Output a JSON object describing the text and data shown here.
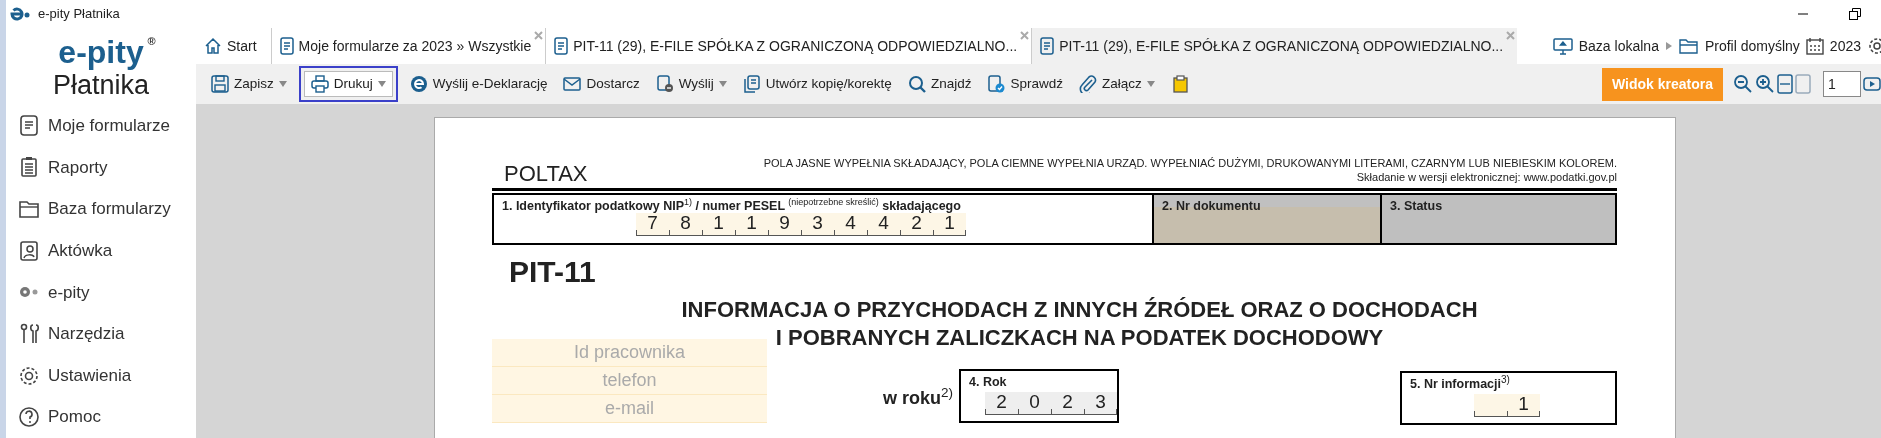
{
  "window": {
    "title": "e-pity Płatnika"
  },
  "sidebar": {
    "logo": {
      "brand": "e-pity",
      "registered": "®",
      "product": "Płatnika"
    },
    "items": [
      {
        "label": "Moje formularze"
      },
      {
        "label": "Raporty"
      },
      {
        "label": "Baza formularzy"
      },
      {
        "label": "Aktówka"
      },
      {
        "label": "e-pity"
      },
      {
        "label": "Narzędzia"
      },
      {
        "label": "Ustawienia"
      },
      {
        "label": "Pomoc"
      }
    ]
  },
  "tabs": [
    {
      "label": "Start",
      "selected": false,
      "closable": false
    },
    {
      "label": "Moje formularze za 2023 » Wszystkie",
      "selected": false,
      "closable": true
    },
    {
      "label": "PIT-11 (29), E-FILE SPÓŁKA Z OGRANICZONĄ ODPOWIEDZIALNO...",
      "selected": false,
      "closable": true
    },
    {
      "label": "PIT-11 (29), E-FILE SPÓŁKA Z OGRANICZONĄ ODPOWIEDZIALNO...",
      "selected": true,
      "closable": true
    }
  ],
  "status": {
    "database": "Baza lokalna",
    "profile": "Profil domyślny",
    "year": "2023"
  },
  "toolbar": {
    "buttons": [
      {
        "label": "Zapisz",
        "dropdown": true,
        "focused": false
      },
      {
        "label": "Drukuj",
        "dropdown": true,
        "focused": true
      },
      {
        "label": "Wyślij e-Deklarację",
        "dropdown": false,
        "focused": false
      },
      {
        "label": "Dostarcz",
        "dropdown": false,
        "focused": false
      },
      {
        "label": "Wyślij",
        "dropdown": true,
        "focused": false
      },
      {
        "label": "Utwórz kopię/korektę",
        "dropdown": false,
        "focused": false
      },
      {
        "label": "Znajdź",
        "dropdown": false,
        "focused": false
      },
      {
        "label": "Sprawdź",
        "dropdown": false,
        "focused": false
      },
      {
        "label": "Załącz",
        "dropdown": true,
        "focused": false
      },
      {
        "dropdown": false,
        "focused": false
      }
    ],
    "mode_button": "Widok kreatora",
    "page": "1"
  },
  "form": {
    "system": "POLTAX",
    "instructions": "POLA JASNE WYPEŁNIA SKŁADAJĄCY, POLA CIEMNE WYPEŁNIA URZĄD. WYPEŁNIAĆ DUŻYMI, DRUKOWANYMI LITERAMI, CZARNYM LUB NIEBIESKIM KOLOREM.",
    "submission": "Składanie w wersji elektronicznej: www.podatki.gov.pl",
    "id_field": {
      "label": "1. Identyfikator podatkowy NIP$^{1)}$ / numer PESEL $^{(niepotrzebne skreślić)}$ składającego",
      "digits": [
        "7",
        "8",
        "1",
        "1",
        "9",
        "3",
        "4",
        "4",
        "2",
        "1"
      ]
    },
    "doc_number": {
      "label": "2. Nr dokumentu"
    },
    "status_field": {
      "label": "3. Status"
    },
    "code": "PIT-11",
    "heading": [
      "INFORMACJA O PRZYCHODACH Z INNYCH ŹRÓDEŁ ORAZ O DOCHODACH",
      "I POBRANYCH ZALICZKACH NA PODATEK DOCHODOWY"
    ],
    "contact_fields": [
      {
        "placeholder": "Id pracownika"
      },
      {
        "placeholder": "telefon"
      },
      {
        "placeholder": "e-mail"
      }
    ],
    "year_caption": "w roku$^{2)}$",
    "year_field": {
      "label": "4. Rok",
      "digits": [
        "2",
        "0",
        "2",
        "3"
      ]
    },
    "info_number": {
      "label": "5. Nr informacji$^{3)}$",
      "digits": [
        "1"
      ]
    }
  }
}
